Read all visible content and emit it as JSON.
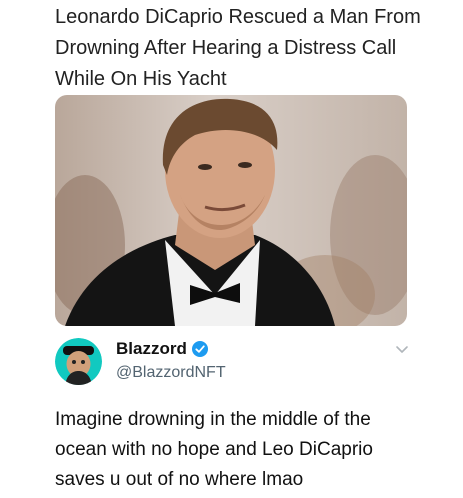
{
  "headline": "Leonardo DiCaprio Rescued a Man From Drowning After Hearing a Distress Call While On His Yacht",
  "photo": {
    "icon": "photo-portrait"
  },
  "tweet": {
    "display_name": "Blazzord",
    "handle": "@BlazzordNFT",
    "verified": true,
    "text": "Imagine drowning in the middle of the ocean with no hope and Leo DiCaprio saves u out of no where lmao"
  },
  "colors": {
    "verified": "#1d9bf0",
    "handle": "#536471",
    "avatar_bg": "#11c9c0"
  }
}
